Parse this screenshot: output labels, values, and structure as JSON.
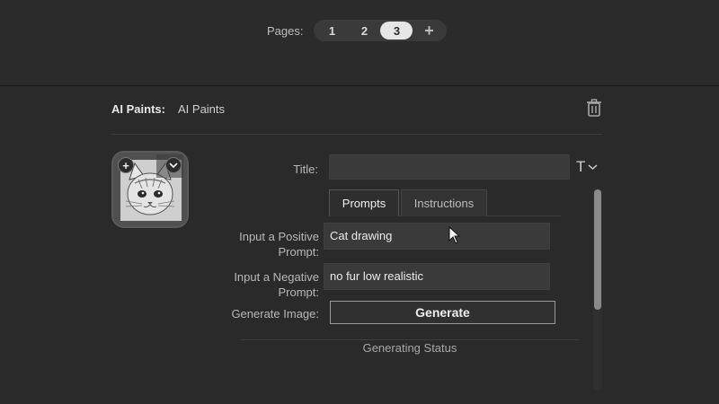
{
  "pagination": {
    "label": "Pages:",
    "pages": [
      "1",
      "2",
      "3"
    ],
    "active_page": "3",
    "add_label": "+"
  },
  "header": {
    "app_label": "AI Paints:",
    "app_name": "AI Paints",
    "delete_icon": "trash-icon"
  },
  "thumbnail": {
    "add_badge": "+",
    "menu_icon": "chevron-down-icon"
  },
  "form": {
    "title_label": "Title:",
    "title_value": "",
    "text_format_icon": "T",
    "tabs": [
      "Prompts",
      "Instructions"
    ],
    "active_tab": "Prompts",
    "positive_label": "Input a Positive Prompt:",
    "positive_value": "Cat drawing",
    "negative_label": "Input a Negative Prompt:",
    "negative_value": "no fur low realistic",
    "generate_label": "Generate Image:",
    "generate_button": "Generate",
    "status_text": "Generating Status"
  },
  "colors": {
    "background": "#272727",
    "active_page": "#e6e6e6",
    "input_bg": "#3a3a3a"
  }
}
